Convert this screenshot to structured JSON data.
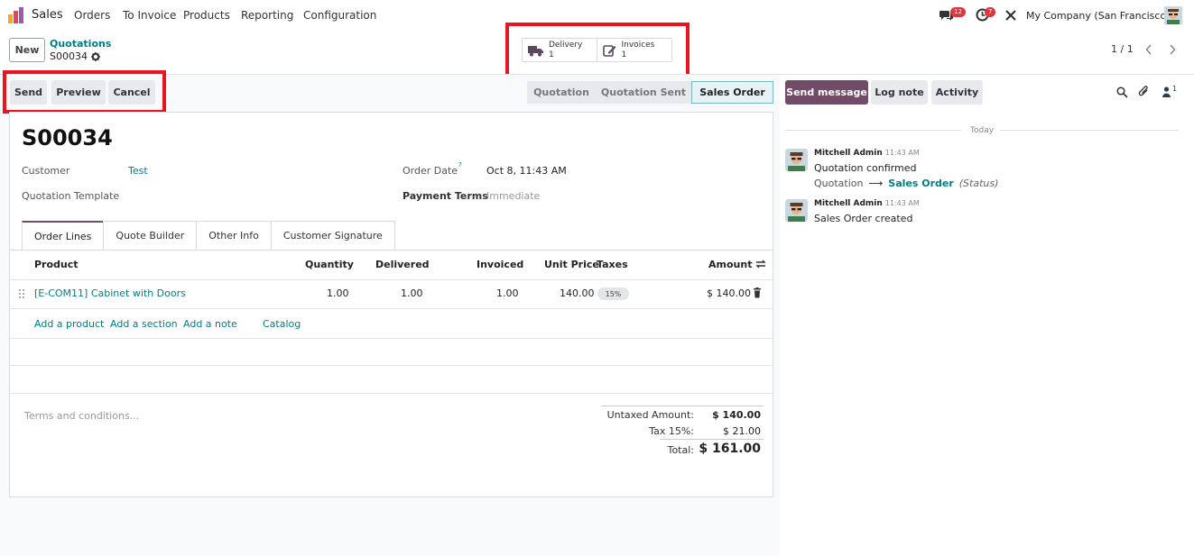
{
  "navbar": {
    "app_name": "Sales",
    "menu": [
      "Orders",
      "To Invoice",
      "Products",
      "Reporting",
      "Configuration"
    ],
    "messages_badge": "12",
    "activities_badge": "7",
    "company": "My Company (San Francisco)"
  },
  "control_panel": {
    "new_label": "New",
    "breadcrumb_parent": "Quotations",
    "breadcrumb_current": "S00034",
    "smart_buttons": [
      {
        "label": "Delivery",
        "count": "1",
        "icon": "truck-icon"
      },
      {
        "label": "Invoices",
        "count": "1",
        "icon": "invoice-edit-icon"
      }
    ],
    "pager": "1 / 1"
  },
  "actions": {
    "send": "Send",
    "preview": "Preview",
    "cancel": "Cancel"
  },
  "statusbar": {
    "stages": [
      "Quotation",
      "Quotation Sent",
      "Sales Order"
    ],
    "active": "Sales Order"
  },
  "form": {
    "title": "S00034",
    "customer_label": "Customer",
    "customer_value": "Test",
    "template_label": "Quotation Template",
    "order_date_label": "Order Date",
    "order_date_help": "?",
    "order_date_value": "Oct 8, 11:43 AM",
    "payment_terms_label": "Payment Terms",
    "payment_terms_value": "Immediate"
  },
  "tabs": [
    "Order Lines",
    "Quote Builder",
    "Other Info",
    "Customer Signature"
  ],
  "order_lines": {
    "headers": {
      "product": "Product",
      "quantity": "Quantity",
      "delivered": "Delivered",
      "invoiced": "Invoiced",
      "unit_price": "Unit Price",
      "taxes": "Taxes",
      "amount": "Amount"
    },
    "rows": [
      {
        "product": "[E-COM11] Cabinet with Doors",
        "quantity": "1.00",
        "delivered": "1.00",
        "invoiced": "1.00",
        "unit_price": "140.00",
        "tax": "15%",
        "amount": "$ 140.00"
      }
    ],
    "add_links": {
      "product": "Add a product",
      "section": "Add a section",
      "note": "Add a note",
      "catalog": "Catalog"
    }
  },
  "totals": {
    "terms_placeholder": "Terms and conditions...",
    "untaxed_label": "Untaxed Amount:",
    "untaxed_value": "$ 140.00",
    "tax_label": "Tax 15%:",
    "tax_value": "$ 21.00",
    "total_label": "Total:",
    "total_value": "$ 161.00"
  },
  "chatter": {
    "send_message": "Send message",
    "log_note": "Log note",
    "activity": "Activity",
    "followers_count": "1",
    "date_separator": "Today",
    "messages": [
      {
        "author": "Mitchell Admin",
        "time": "11:43 AM",
        "body": "Quotation confirmed",
        "tracking_from": "Quotation",
        "tracking_to": "Sales Order",
        "tracking_field": "(Status)"
      },
      {
        "author": "Mitchell Admin",
        "time": "11:43 AM",
        "body": "Sales Order created"
      }
    ]
  },
  "colors": {
    "brand": "#714b67",
    "link": "#017e84",
    "highlight": "#e8141e"
  }
}
